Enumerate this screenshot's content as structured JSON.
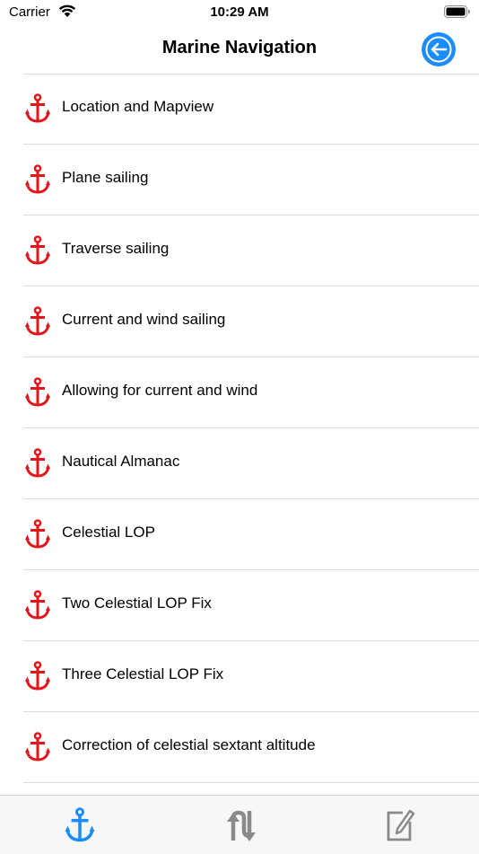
{
  "status_bar": {
    "carrier": "Carrier",
    "time": "10:29 AM"
  },
  "nav": {
    "title": "Marine Navigation",
    "back_icon": "arrow-left-circle-icon"
  },
  "items": [
    {
      "label": "Location and Mapview"
    },
    {
      "label": "Plane sailing"
    },
    {
      "label": "Traverse sailing"
    },
    {
      "label": "Current and wind sailing"
    },
    {
      "label": "Allowing for current and wind"
    },
    {
      "label": "Nautical Almanac"
    },
    {
      "label": "Celestial LOP"
    },
    {
      "label": "Two Celestial LOP Fix"
    },
    {
      "label": "Three Celestial LOP Fix"
    },
    {
      "label": "Correction of celestial sextant altitude"
    }
  ],
  "item_icon": "anchor-icon",
  "tabs": [
    {
      "icon": "anchor-icon",
      "selected": true
    },
    {
      "icon": "swap-arrows-icon",
      "selected": false
    },
    {
      "icon": "edit-note-icon",
      "selected": false
    }
  ],
  "colors": {
    "anchor_red": "#e0161b",
    "accent_blue": "#1a8cff",
    "tab_inactive": "#8a8a8a"
  }
}
